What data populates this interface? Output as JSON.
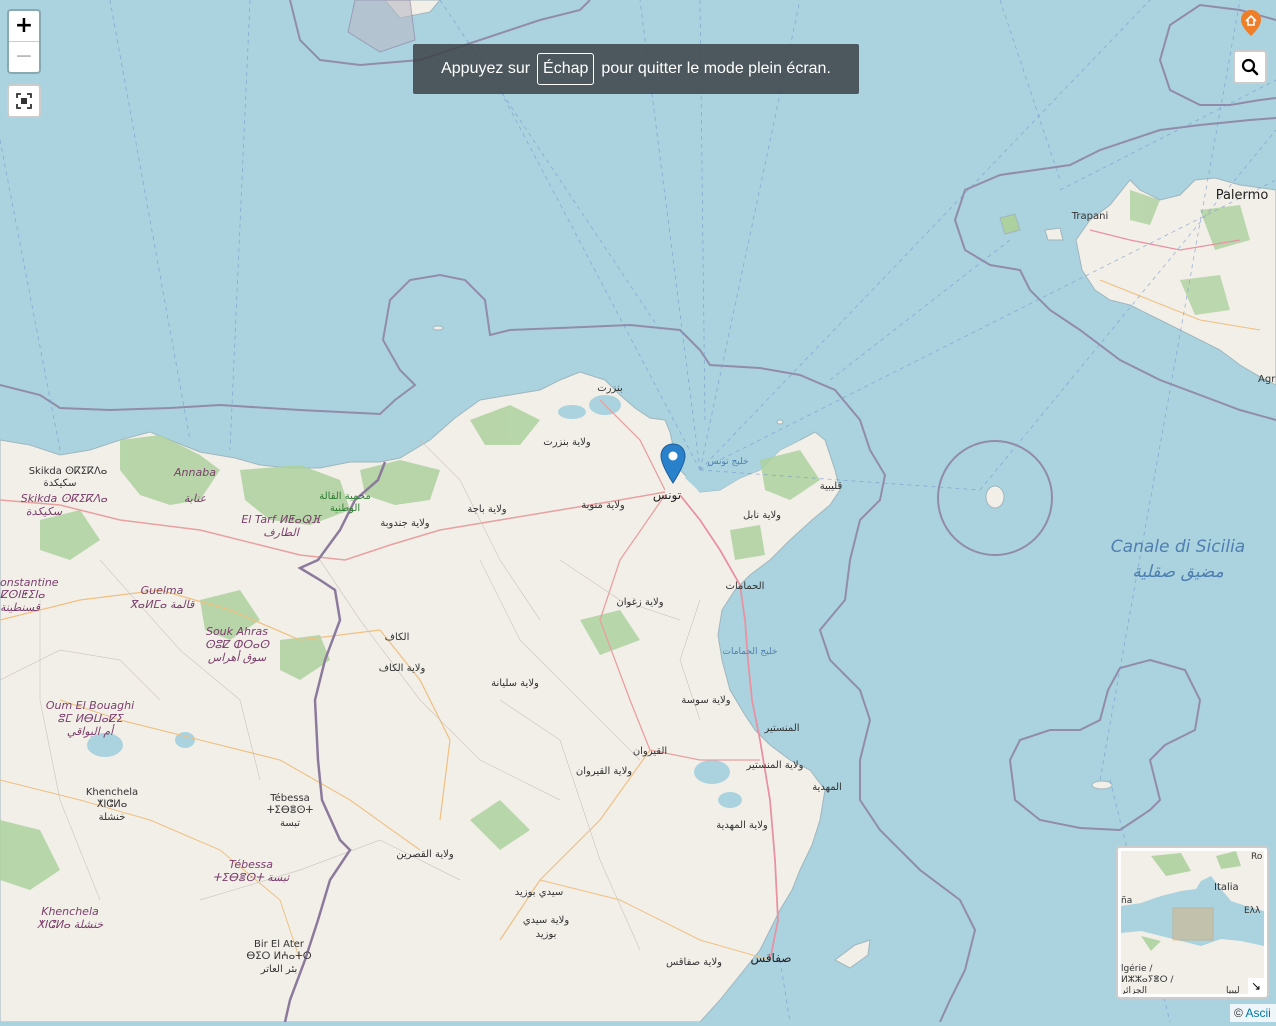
{
  "controls": {
    "zoom_in": "+",
    "zoom_out": "−"
  },
  "toast": {
    "before": "Appuyez sur",
    "key": "Échap",
    "after": "pour quitter le mode plein écran."
  },
  "sea_labels": {
    "canale_it": "Canale di Sicilia",
    "canale_ar": "مضيق صقلية"
  },
  "places": {
    "bizerte": "بنزرت",
    "wilaya_bizerte": "ولاية بنزرت",
    "gulf_tunis": "خليج تونس",
    "tunis": "تونس",
    "wilaya_beja": "ولاية باجة",
    "wilaya_manouba": "ولاية منوبة",
    "wilaya_jendouba": "ولاية جندوبة",
    "kelibia": "قليبية",
    "wilaya_nabeul": "ولاية نابل",
    "hammamet": "الحمامات",
    "wilaya_zaghouan": "ولاية زغوان",
    "gulf_hammamet": "خليج الحمامات",
    "kef": "الكاف",
    "wilaya_kef": "ولاية الكاف",
    "wilaya_siliana": "ولاية سليانة",
    "wilaya_sousse": "ولاية سوسة",
    "monastir": "المنستير",
    "kairouan": "القيروان",
    "wilaya_monastir": "ولاية المنستير",
    "wilaya_kairouan": "ولاية القيروان",
    "mahdia": "المهدية",
    "wilaya_mahdia": "ولاية المهدية",
    "wilaya_kasserine": "ولاية القصرين",
    "sidi_bouzid": "سيدي بوزيد",
    "wilaya_sidi_bouzid_1": "ولاية سيدي",
    "wilaya_sidi_bouzid_2": "بوزيد",
    "wilaya_sfax": "ولاية صفاقس",
    "sfax": "صفاقس",
    "trapani": "Trapani",
    "palermo": "Palermo",
    "agr": "Agr",
    "skikda_1": "Skikda ⵙⴽⵉⴽⴷⴰ",
    "skikda_2": "سكيكدة",
    "skikda_it_1": "Skikda ⵙⴽⵉⴽⴷⴰ",
    "skikda_it_2": "سكيكدة",
    "annaba_1": "Annaba",
    "annaba_2": "عنابة",
    "el_kala_1": "محمية القالة",
    "el_kala_2": "الوطنية",
    "el_tarf_1": "El Tarf ⵍⵟⴰⵕⴼ",
    "el_tarf_2": "الطارف",
    "constantine_1": "onstantine",
    "constantine_2": "ⵇⵙⵏⵟⵉⵏⴰ",
    "constantine_3": "قسنطينة",
    "guelma_1": "Guelma",
    "guelma_2": "ⴳⴰⵍⵎⴰ قالمة",
    "souk_ahras_1": "Souk Ahras",
    "souk_ahras_2": "ⵙⵓⵇ ⵀⵔⴰⵙ",
    "souk_ahras_3": "سوق أهراس",
    "oum_1": "Oum El Bouaghi",
    "oum_2": "ⵓⵎ ⵍⴱⵡⴰⵇⵉ",
    "oum_3": "أم البواقي",
    "khenchela_1": "Khenchela",
    "khenchela_2": "ⵅⵏⵛⵍⴰ",
    "khenchela_3": "خنشلة",
    "tebessa_1": "Tébessa",
    "tebessa_2": "ⵜⵉⴱⴻⵙⵜ",
    "tebessa_3": "تبسة",
    "tebessa_it_1": "Tébessa",
    "tebessa_it_2": "ⵜⵉⴱⴻⵙⵜ تبسة",
    "khenchela_it_1": "Khenchela",
    "khenchela_it_2": "ⵅⵏⵛⵍⴰ خنشلة",
    "bir_1": "Bir El Ater",
    "bir_2": "ⴱⵉⵔ ⵍⵄⴰⵜⵔ",
    "bir_3": "بئر العاتر"
  },
  "minimap": {
    "italia": "Italia",
    "ru": "Ro",
    "ell": "Ελλ",
    "na": "ña",
    "algerie_1": "lgérie /",
    "algerie_2": "ⵍⵣⵣⴰⵢⴻⵔ /",
    "algerie_3": "الجزائر",
    "libya": "ليبيا",
    "toggle": "↘"
  },
  "attribution": {
    "symbol": "©",
    "link": "Ascii"
  },
  "colors": {
    "sea": "#aad3df",
    "land": "#f2efe9",
    "border": "#8c7a9c",
    "forest": "#add19e",
    "marker": "#2a81cb",
    "home_marker": "#f07d28"
  }
}
